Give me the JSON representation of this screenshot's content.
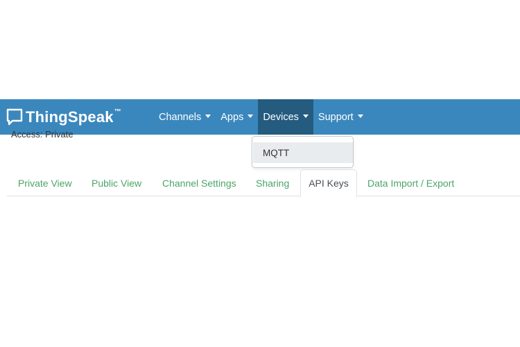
{
  "navbar": {
    "brand_name": "ThingSpeak",
    "brand_tm": "™",
    "background_color": "#3a87bd",
    "active_color": "#245b7f",
    "items": [
      {
        "label": "Channels",
        "icon": "caret-down-icon"
      },
      {
        "label": "Apps",
        "icon": "caret-down-icon"
      },
      {
        "label": "Devices",
        "icon": "caret-down-icon",
        "active": true
      },
      {
        "label": "Support",
        "icon": "caret-down-icon"
      }
    ]
  },
  "devices_menu": {
    "items": [
      {
        "label": "MQTT"
      }
    ]
  },
  "channel": {
    "access": "Access: Private"
  },
  "tabs": {
    "items": [
      {
        "label": "Private View"
      },
      {
        "label": "Public View"
      },
      {
        "label": "Channel Settings"
      },
      {
        "label": "Sharing"
      },
      {
        "label": "API Keys",
        "active": true
      },
      {
        "label": "Data Import / Export"
      }
    ],
    "link_color": "#4aa564"
  }
}
